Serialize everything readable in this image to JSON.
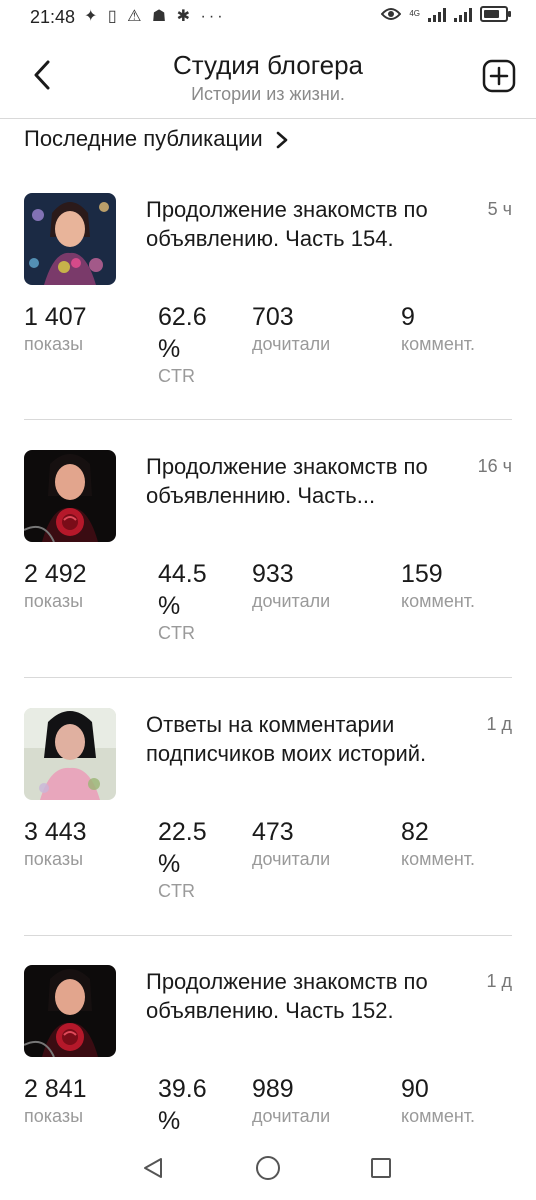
{
  "status_bar": {
    "time": "21:48",
    "left_icons": "✦ ▯ ⚠ ☗ ✱ ···",
    "network": "4G",
    "battery_level": 0.75
  },
  "header": {
    "title": "Студия блогера",
    "subtitle": "Истории из жизни."
  },
  "section": {
    "title": "Последние публикации"
  },
  "labels": {
    "views": "показы",
    "ctr_unit": "%",
    "ctr": "CTR",
    "reads": "дочитали",
    "comments": "коммент."
  },
  "posts": [
    {
      "title": "Продолжение знакомств по объявлению. Часть 154.",
      "time": "5 ч",
      "views": "1 407",
      "ctr": "62.6",
      "reads": "703",
      "comments": "9"
    },
    {
      "title": "Продолжение знакомств по объявленнию. Часть...",
      "time": "16 ч",
      "views": "2 492",
      "ctr": "44.5",
      "reads": "933",
      "comments": "159"
    },
    {
      "title": "Ответы на комментарии подписчиков моих историй.",
      "time": "1 д",
      "views": "3 443",
      "ctr": "22.5",
      "reads": "473",
      "comments": "82"
    },
    {
      "title": "Продолжение знакомств по объявлению. Часть 152.",
      "time": "1 д",
      "views": "2 841",
      "ctr": "39.6",
      "reads": "989",
      "comments": "90"
    }
  ],
  "icons": {
    "back": "back-arrow-icon",
    "add": "add-square-icon",
    "chevron": "chevron-right-icon",
    "nav_back": "nav-back-icon",
    "nav_home": "nav-home-icon",
    "nav_recents": "nav-recents-icon"
  }
}
